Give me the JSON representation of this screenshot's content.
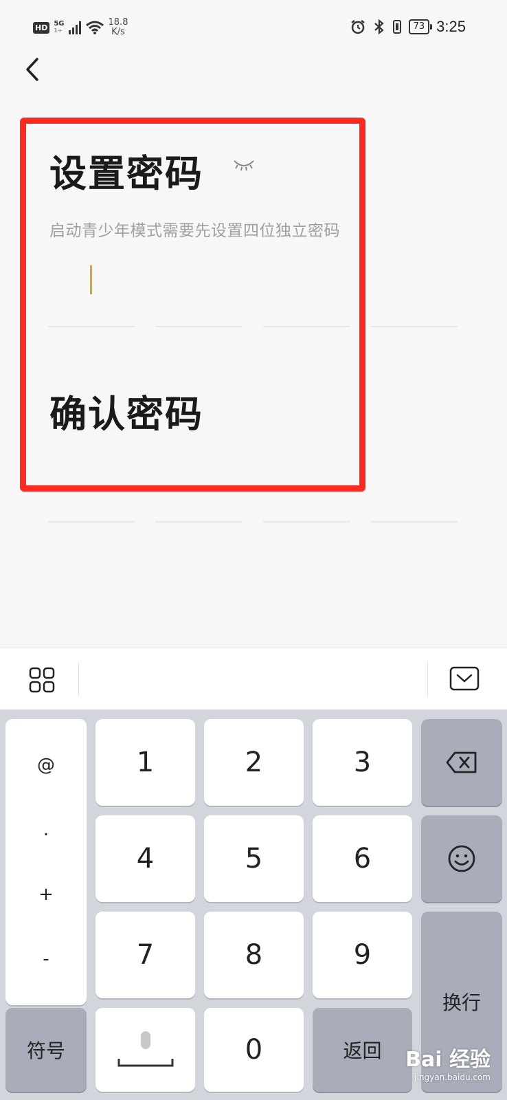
{
  "status_bar": {
    "hd_badge": "HD",
    "network": "5G",
    "network_sub": "1+",
    "speed_value": "18.8",
    "speed_unit": "K/s",
    "battery": "73",
    "time": "3:25"
  },
  "page": {
    "set_password_title": "设置密码",
    "set_password_hint": "启动青少年模式需要先设置四位独立密码",
    "confirm_password_title": "确认密码"
  },
  "keyboard": {
    "left_column": [
      "@",
      ".",
      "+",
      "-"
    ],
    "keys": {
      "k1": "1",
      "k2": "2",
      "k3": "3",
      "k4": "4",
      "k5": "5",
      "k6": "6",
      "k7": "7",
      "k8": "8",
      "k9": "9",
      "k0": "0"
    },
    "symbols_label": "符号",
    "return_label": "返回",
    "newline_label": "换行"
  },
  "watermark": {
    "brand": "Bai 经验",
    "url": "jingyan.baidu.com"
  },
  "colors": {
    "highlight_border": "#ff2a1f",
    "cursor": "#d4a72c",
    "keyboard_bg": "#d3d5dc"
  }
}
